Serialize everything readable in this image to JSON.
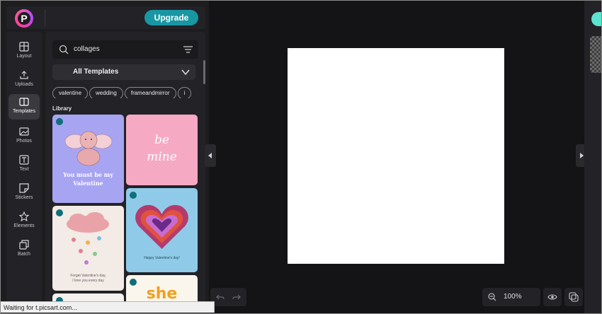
{
  "header": {
    "upgrade_label": "Upgrade"
  },
  "nav": {
    "items": [
      {
        "label": "Layout",
        "icon": "layout-icon"
      },
      {
        "label": "Uploads",
        "icon": "upload-icon"
      },
      {
        "label": "Templates",
        "icon": "templates-icon",
        "active": true
      },
      {
        "label": "Photos",
        "icon": "photos-icon"
      },
      {
        "label": "Text",
        "icon": "text-icon"
      },
      {
        "label": "Stickers",
        "icon": "stickers-icon"
      },
      {
        "label": "Elements",
        "icon": "elements-icon"
      },
      {
        "label": "Batch",
        "icon": "batch-icon"
      }
    ]
  },
  "panel": {
    "search_value": "collages",
    "category": "All Templates",
    "tags": [
      "valentine",
      "wedding",
      "frameandmirror",
      "i"
    ],
    "section_title": "Library",
    "templates": [
      {
        "caption_line1": "You must be my",
        "caption_line2": "Valentine"
      },
      {
        "caption_line1": "be",
        "caption_line2": "mine"
      },
      {
        "caption_line1": "Happy Valentine's day!"
      },
      {
        "caption_line1": "Forget Valentine's day,",
        "caption_line2": "I love you every day"
      },
      {
        "caption_line1": "she"
      }
    ]
  },
  "toolbar": {
    "zoom_level": "100%"
  },
  "status": {
    "text": "Waiting for t.picsart.com..."
  },
  "colors": {
    "accent": "#1897a3",
    "panel": "#222227",
    "background": "#1d1d20"
  }
}
